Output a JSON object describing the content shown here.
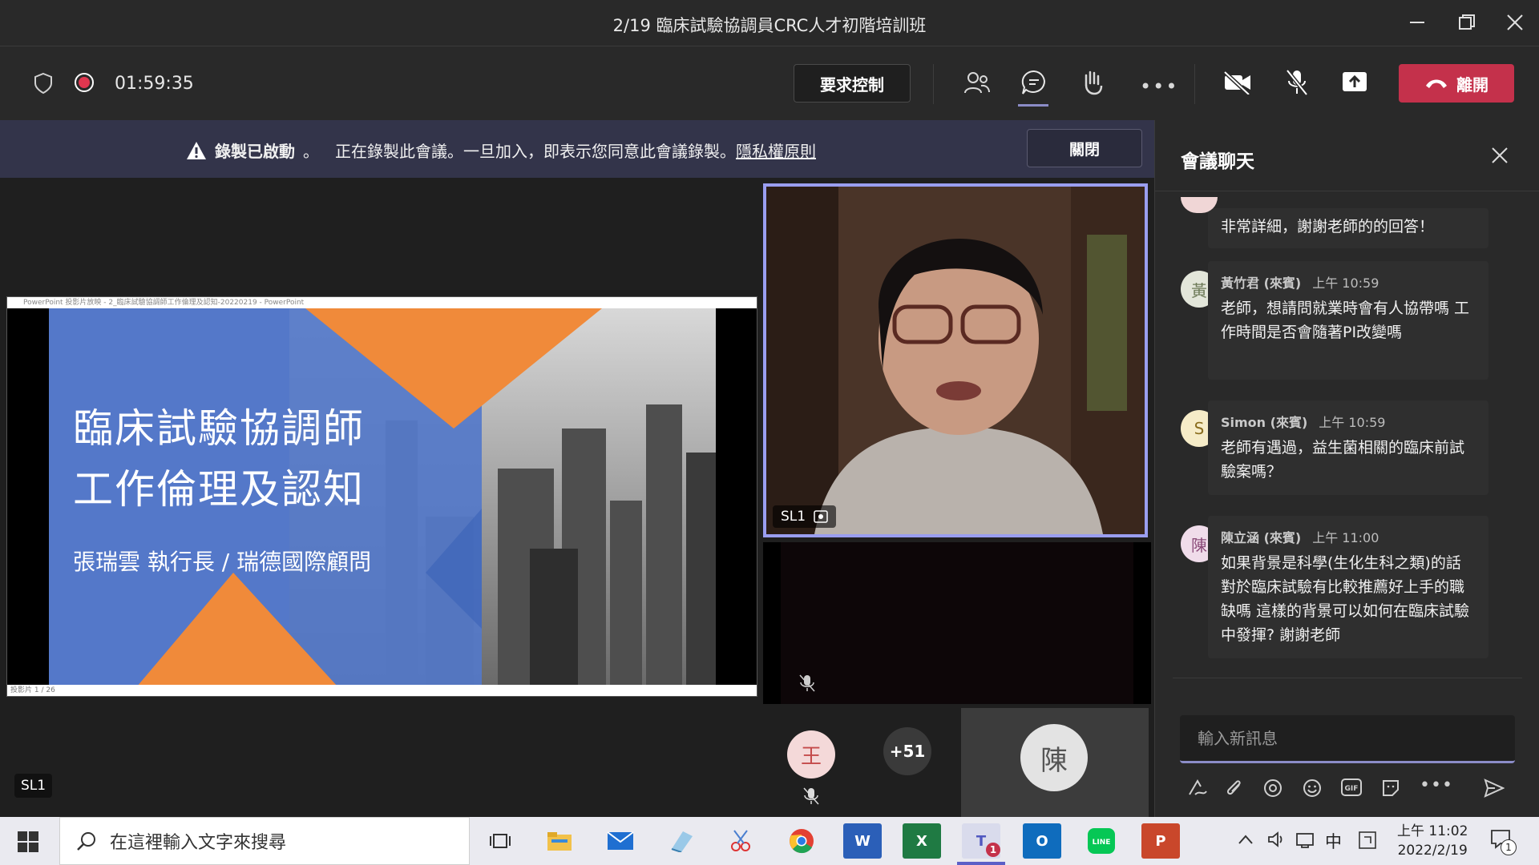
{
  "window": {
    "title": "2/19 臨床試驗協調員CRC人才初階培訓班"
  },
  "toolbar": {
    "timer": "01:59:35",
    "request_control": "要求控制",
    "leave": "離開"
  },
  "banner": {
    "bold": "錄製已啟動",
    "text": "正在錄製此會議。一旦加入，即表示您同意此會議錄製。",
    "link": "隱私權原則",
    "close": "關閉"
  },
  "slide": {
    "titlebar": "PowerPoint 投影片放映 - 2_臨床試驗協調師工作倫理及認知-20220219 - PowerPoint",
    "title_line1": "臨床試驗協調師",
    "title_line2": "工作倫理及認知",
    "subtitle": "張瑞雲  執行長 / 瑞德國際顧問",
    "slide_count": "投影片 1 / 26"
  },
  "stage": {
    "main_video_label": "SL1",
    "presenter_badge": "SL1",
    "participant_wang": "王",
    "more_count": "+51",
    "participant_chen": "陳"
  },
  "chat": {
    "title": "會議聊天",
    "partial_message": "非常詳細，謝謝老師的的回答！",
    "messages": [
      {
        "avatar": "黃",
        "name": "黃竹君 (來賓)",
        "time": "上午 10:59",
        "text": "老師，想請問就業時會有人協帶嗎 工作時間是否會隨著PI改變嗎"
      },
      {
        "avatar": "S",
        "name": "Simon (來賓)",
        "time": "上午 10:59",
        "text": "老師有遇過，益生菌相關的臨床前試驗案嗎？"
      },
      {
        "avatar": "陳",
        "name": "陳立涵 (來賓)",
        "time": "上午 11:00",
        "text": "如果背景是科學(生化生科之類)的話對於臨床試驗有比較推薦好上手的職缺嗎 這樣的背景可以如何在臨床試驗中發揮? 謝謝老師"
      }
    ],
    "input_placeholder": "輸入新訊息"
  },
  "taskbar": {
    "search_placeholder": "在這裡輸入文字來搜尋",
    "teams_badge": "1",
    "ime": "中",
    "time": "上午 11:02",
    "date": "2022/2/19",
    "notification_count": "1"
  },
  "colors": {
    "leave": "#c4314b",
    "accent": "#8b8cc7",
    "banner": "#33344a"
  }
}
